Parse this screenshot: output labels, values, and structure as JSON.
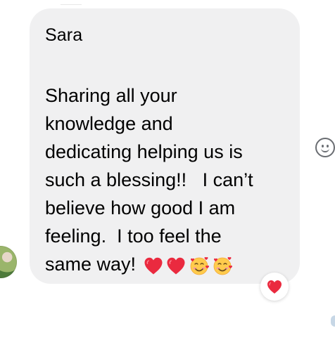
{
  "message": {
    "sender_name": "Sara",
    "lines": [
      "Sharing all your",
      "knowledge and",
      "dedicating helping us is",
      "such a blessing!!   I can’t",
      "believe how good I am",
      "feeling.  I too feel the",
      "same way!"
    ],
    "emoji_sequence": [
      "red-heart",
      "red-heart",
      "smiling-face-with-hearts",
      "smiling-face-with-hearts"
    ]
  },
  "reaction": {
    "emoji": "red-heart"
  },
  "icons": {
    "add_reaction": "smiley-face-icon",
    "avatar": "avatar"
  },
  "colors": {
    "bubble_background": "#f0f0f1",
    "heart_red": "#ea2a3f",
    "icon_gray": "#6a6d72"
  }
}
